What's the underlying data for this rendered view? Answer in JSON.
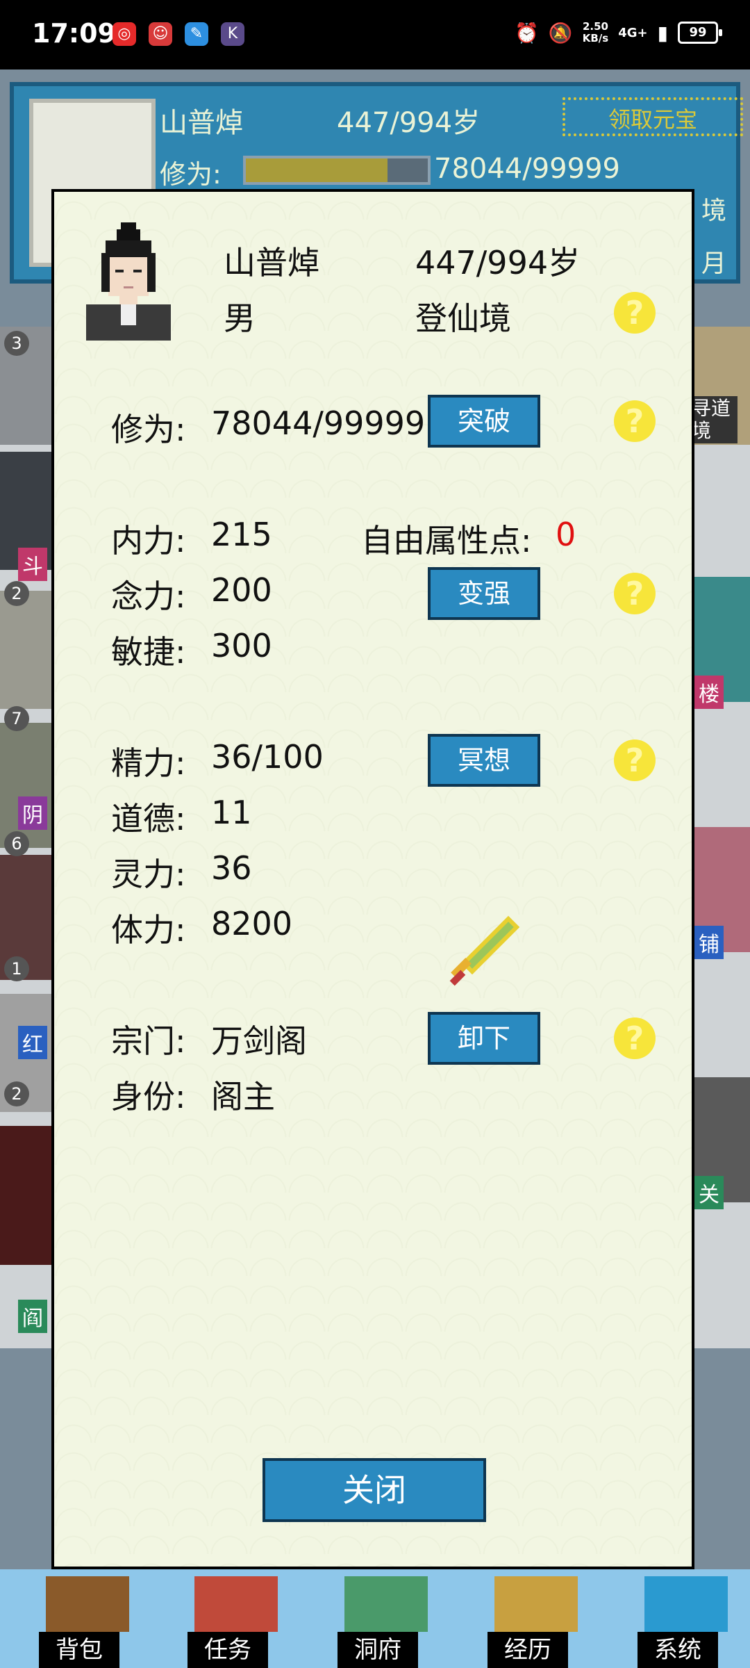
{
  "status_bar": {
    "time": "17:09",
    "net_speed_value": "2.50",
    "net_speed_unit": "KB/s",
    "network": "4G+",
    "battery": "99",
    "app_icons": [
      "netease-music-icon",
      "app-icon-red",
      "qq-icon",
      "k-icon"
    ]
  },
  "background": {
    "name": "山普焯",
    "age": "447/994岁",
    "reward_button": "领取元宝",
    "cultivation_label": "修为:",
    "cultivation_value": "78044/99999",
    "cultivation_progress": 0.78,
    "side_texts": [
      "境",
      "月"
    ],
    "list_numbers": [
      "3",
      "2",
      "7",
      "6",
      "1",
      "2"
    ],
    "left_tags": [
      "斗",
      "阴",
      "红",
      "阎"
    ],
    "right_tags": [
      "寻道境",
      "楼",
      "铺",
      "关"
    ]
  },
  "bottom_nav": {
    "items": [
      "背包",
      "任务",
      "洞府",
      "经历",
      "系统"
    ]
  },
  "dialog": {
    "name": "山普焯",
    "age": "447/994岁",
    "gender": "男",
    "realm": "登仙境",
    "cultivation_label": "修为:",
    "cultivation_value": "78044/99999",
    "breakthrough_button": "突破",
    "neili_label": "内力:",
    "neili_value": "215",
    "free_points_label": "自由属性点:",
    "free_points_value": "0",
    "nianli_label": "念力:",
    "nianli_value": "200",
    "strengthen_button": "变强",
    "minjie_label": "敏捷:",
    "minjie_value": "300",
    "jingli_label": "精力:",
    "jingli_value": "36/100",
    "meditate_button": "冥想",
    "daode_label": "道德:",
    "daode_value": "11",
    "lingli_label": "灵力:",
    "lingli_value": "36",
    "tili_label": "体力:",
    "tili_value": "8200",
    "sect_label": "宗门:",
    "sect_value": "万剑阁",
    "unequip_button": "卸下",
    "identity_label": "身份:",
    "identity_value": "阁主",
    "help_symbol": "?",
    "close_button": "关闭",
    "colors": {
      "button": "#2a8ac0",
      "help": "#f7e53a",
      "free_points": "#e01010"
    }
  }
}
